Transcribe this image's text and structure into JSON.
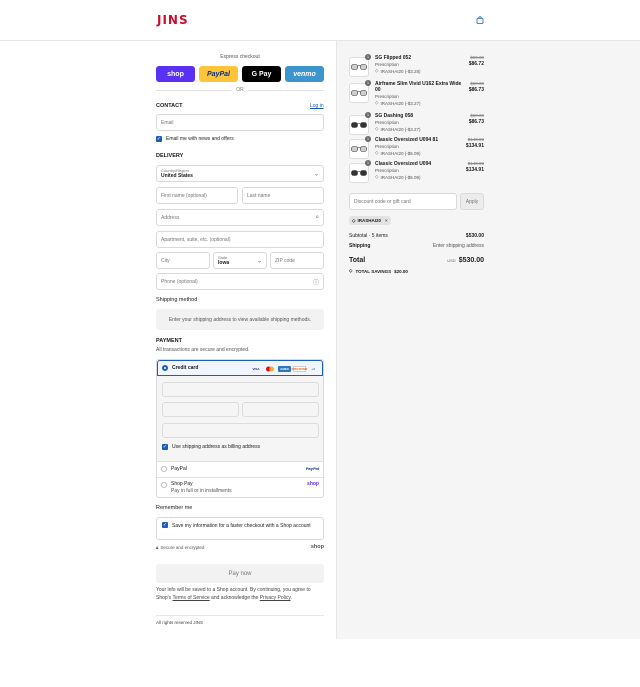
{
  "header": {
    "logo": "JINS",
    "cart_icon": "bag-icon"
  },
  "express": {
    "title": "Express checkout",
    "buttons": [
      "shop",
      "PayPal",
      "G Pay",
      "venmo"
    ],
    "or": "OR"
  },
  "contact": {
    "title": "CONTACT",
    "login": "Log in",
    "email_placeholder": "Email",
    "news_label": "Email me with news and offers"
  },
  "delivery": {
    "title": "DELIVERY",
    "country_label": "Country/Region",
    "country_value": "United States",
    "first_name": "First name (optional)",
    "last_name": "Last name",
    "address": "Address",
    "apartment": "Apartment, suite, etc. (optional)",
    "city": "City",
    "state_label": "State",
    "state_value": "Iowa",
    "zip": "ZIP code",
    "phone": "Phone (optional)"
  },
  "shipping": {
    "title": "Shipping method",
    "note": "Enter your shipping address to view available shipping methods."
  },
  "payment": {
    "title": "PAYMENT",
    "subtitle": "All transactions are secure and encrypted.",
    "credit_card": "Credit card",
    "card_logos": [
      "VISA",
      "MC",
      "AMEX",
      "DISCOVER",
      "+4"
    ],
    "billing_label": "Use shipping address as billing address",
    "paypal": "PayPal",
    "paypal_logo": "PayPal",
    "shoppay": "Shop Pay",
    "shoppay_sub": "Pay in full or in installments",
    "shoppay_logo": "shop"
  },
  "remember": {
    "title": "Remember me",
    "label": "Save my information for a faster checkout with a Shop account",
    "secure": "Secure and encrypted",
    "shop_logo": "shop"
  },
  "pay_button": "Pay now",
  "legal": {
    "text1": "Your info will be saved to a Shop account. By continuing, you agree to Shop's ",
    "terms": "Terms of Service",
    "text2": " and acknowledge the ",
    "privacy": "Privacy Policy",
    "text3": "."
  },
  "footer": "All rights reserved JINS",
  "cart": {
    "items": [
      {
        "qty": "1",
        "name": "SG Flipped 052",
        "sub": "Prescription",
        "discount": "IRASHAI20 (-$3.28)",
        "orig": "$90.00",
        "price": "$86.72"
      },
      {
        "qty": "1",
        "name": "Airframe Slim Vivid U162 Extra Wide 00",
        "sub": "Prescription",
        "discount": "IRASHAI20 (-$3.27)",
        "orig": "$90.00",
        "price": "$86.73"
      },
      {
        "qty": "1",
        "name": "SG Dashing 058",
        "sub": "Prescription",
        "discount": "IRASHAI20 (-$3.27)",
        "orig": "$90.00",
        "price": "$86.73"
      },
      {
        "qty": "1",
        "name": "Classic Oversized U094 81",
        "sub": "Prescription",
        "discount": "IRASHAI20 (-$5.09)",
        "orig": "$140.00",
        "price": "$134.91"
      },
      {
        "qty": "1",
        "name": "Classic Oversized U094",
        "sub": "Prescription",
        "discount": "IRASHAI20 (-$5.09)",
        "orig": "$140.00",
        "price": "$134.91"
      }
    ],
    "discount_placeholder": "Discount code or gift card",
    "apply": "Apply",
    "chip": "IRASHAI20",
    "subtotal_label": "Subtotal · 5 items",
    "subtotal_value": "$530.00",
    "shipping_label": "Shipping",
    "shipping_value": "Enter shipping address",
    "total_label": "Total",
    "currency": "USD",
    "total_value": "$530.00",
    "savings_label": "TOTAL SAVINGS",
    "savings_value": "$20.00"
  }
}
